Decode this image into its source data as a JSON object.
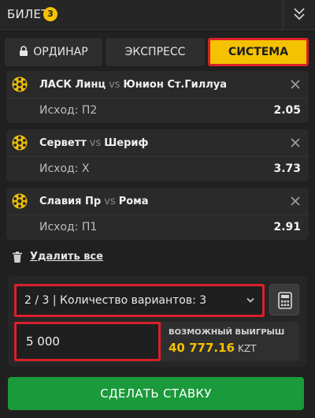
{
  "header": {
    "title": "БИЛЕТ",
    "count": "3",
    "collapse_icon": "double-chevron-down-icon"
  },
  "tabs": [
    {
      "label": "ОРДИНАР",
      "icon": "lock-icon"
    },
    {
      "label": "ЭКСПРЕСС"
    },
    {
      "label": "СИСТЕМА",
      "active": true
    }
  ],
  "bets": [
    {
      "home": "ЛАСК Линц",
      "vs": "vs",
      "away": "Юнион Ст.Гиллуа",
      "outcome": "Исход: П2",
      "odds": "2.05"
    },
    {
      "home": "Серветт",
      "vs": "vs",
      "away": "Шериф",
      "outcome": "Исход: X",
      "odds": "3.73"
    },
    {
      "home": "Славия Пр",
      "vs": "vs",
      "away": "Рома",
      "outcome": "Исход: П1",
      "odds": "2.91"
    }
  ],
  "remove_all": "Удалить все",
  "system": {
    "selected": "2 / 3  |  Количество вариантов: 3"
  },
  "stake": {
    "value": "5 000"
  },
  "winnings": {
    "label": "ВОЗМОЖНЫЙ ВЫИГРЫШ",
    "amount": "40 777.16",
    "currency": "KZT"
  },
  "submit_label": "СДЕЛАТЬ СТАВКУ",
  "colors": {
    "accent": "#f4c200",
    "submit": "#1a9a3a",
    "highlight": "#d9202a"
  }
}
